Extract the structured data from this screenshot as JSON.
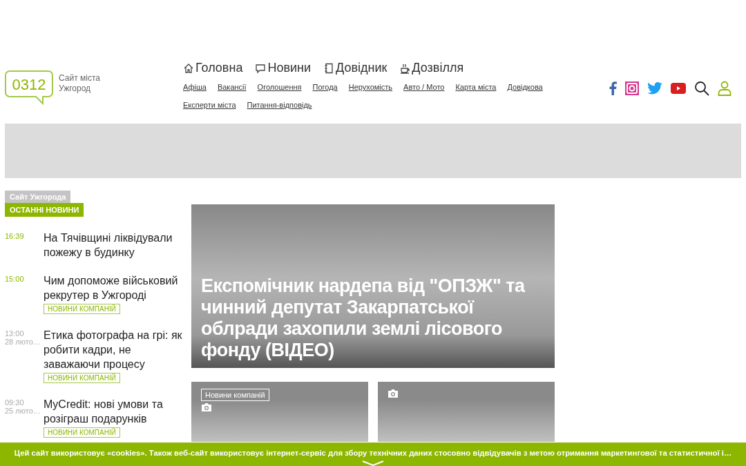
{
  "logo": {
    "code": "0312",
    "line1": "Сайт міста",
    "line2": "Ужгород"
  },
  "main_nav": [
    {
      "kind": "home",
      "label": "Головна"
    },
    {
      "kind": "chat",
      "label": "Новини"
    },
    {
      "kind": "notebook",
      "label": "Довідник"
    },
    {
      "kind": "cup",
      "label": "Дозвілля"
    }
  ],
  "sub_nav": [
    "Афіша",
    "Вакансії",
    "Оголошення",
    "Погода",
    "Нерухомість",
    "Авто / Мото",
    "Карта міста",
    "Довідкова",
    "Експерти міста",
    "Питання-відповідь"
  ],
  "social": [
    {
      "kind": "facebook"
    },
    {
      "kind": "instagram"
    },
    {
      "kind": "twitter"
    },
    {
      "kind": "youtube"
    }
  ],
  "sidebar": {
    "site_label": "Сайт Ужгорода",
    "heading": "ОСТАННІ НОВИНИ",
    "items": [
      {
        "time": "16:39",
        "fresh": true,
        "title": "На Тячівщині ліквідували пожежу в будинку"
      },
      {
        "time": "15:00",
        "fresh": true,
        "title": "Чим допоможе військовий рекрутер в Ужгороді",
        "tag": "НОВИНИ КОМПАНІЙ"
      },
      {
        "time": "13:00",
        "date": "28 люто…",
        "fresh": false,
        "title": "Етика фотографа на грі: як робити кадри, не заважаючи процесу",
        "tag": "НОВИНИ КОМПАНІЙ"
      },
      {
        "time": "09:30",
        "date": "25 люто…",
        "fresh": false,
        "title": "MyCredit: нові умови та розіграш подарунків",
        "tag": "НОВИНИ КОМПАНІЙ"
      }
    ]
  },
  "featured": {
    "title": "Експомічник нардепа від \"ОПЗЖ\" та чинний депутат Закарпатської облради захопили землі лісового фонду (ВІДЕО)"
  },
  "cards": [
    {
      "kind": "photo",
      "tag": "Новини компаній"
    },
    {
      "kind": "photo"
    }
  ],
  "cookie_notice": "Цей сайт використовує «cookies». Також веб-сайт використовує інтернет-сервіс для збору технічних даних стосовно відвідувачів з метою отримання маркетингової та статистичної і…"
}
